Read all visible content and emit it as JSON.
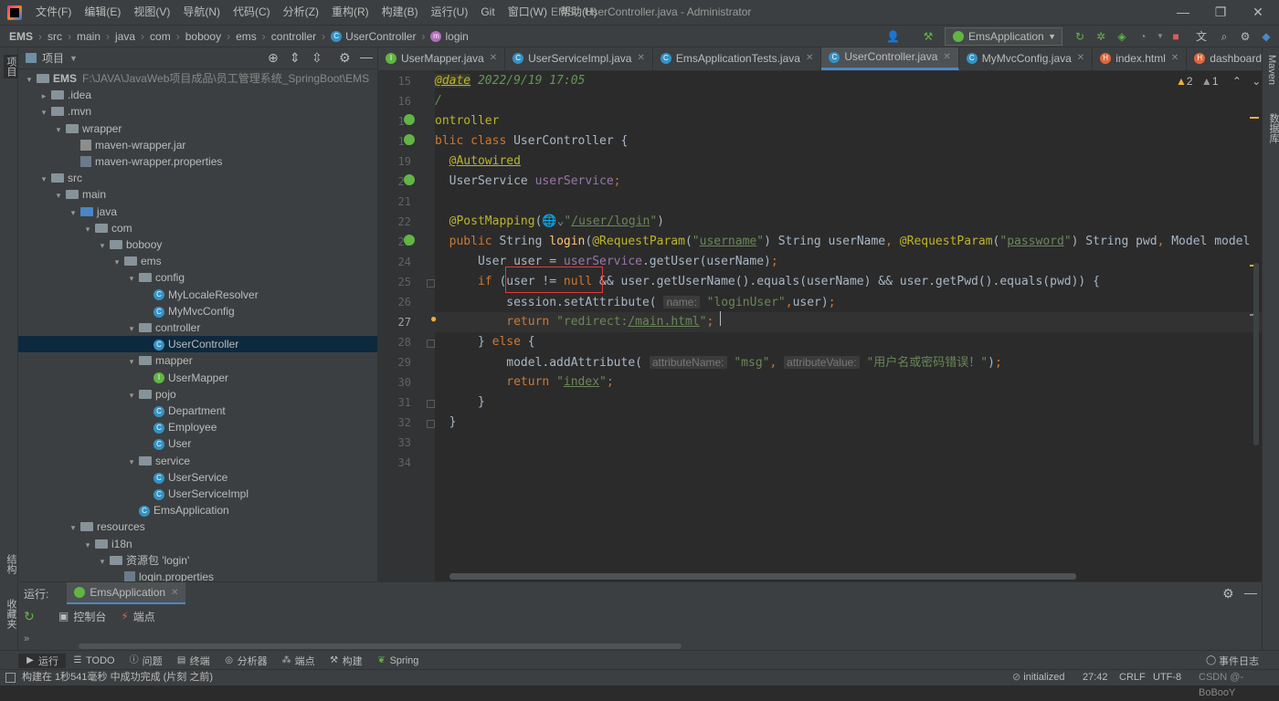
{
  "menubar": {
    "items": [
      "文件(F)",
      "编辑(E)",
      "视图(V)",
      "导航(N)",
      "代码(C)",
      "分析(Z)",
      "重构(R)",
      "构建(B)",
      "运行(U)",
      "Git",
      "窗口(W)",
      "帮助(H)"
    ],
    "window_title": "EMS - UserController.java - Administrator"
  },
  "navbar": {
    "crumbs": [
      "EMS",
      "src",
      "main",
      "java",
      "com",
      "bobooy",
      "ems",
      "controller",
      "UserController",
      "login"
    ],
    "run_config": "EmsApplication"
  },
  "project_panel": {
    "title": "项目",
    "tree": [
      {
        "depth": 0,
        "arrow": "▾",
        "icon": "folder",
        "label": "EMS",
        "extra": "F:\\JAVA\\JavaWeb项目成品\\员工管理系统_SpringBoot\\EMS",
        "bold": true
      },
      {
        "depth": 1,
        "arrow": "▸",
        "icon": "folder",
        "label": ".idea"
      },
      {
        "depth": 1,
        "arrow": "▾",
        "icon": "folder",
        "label": ".mvn"
      },
      {
        "depth": 2,
        "arrow": "▾",
        "icon": "folder",
        "label": "wrapper"
      },
      {
        "depth": 3,
        "arrow": "",
        "icon": "jar",
        "label": "maven-wrapper.jar"
      },
      {
        "depth": 3,
        "arrow": "",
        "icon": "prop",
        "label": "maven-wrapper.properties"
      },
      {
        "depth": 1,
        "arrow": "▾",
        "icon": "folder",
        "label": "src"
      },
      {
        "depth": 2,
        "arrow": "▾",
        "icon": "folder",
        "label": "main"
      },
      {
        "depth": 3,
        "arrow": "▾",
        "icon": "src",
        "label": "java"
      },
      {
        "depth": 4,
        "arrow": "▾",
        "icon": "folder",
        "label": "com"
      },
      {
        "depth": 5,
        "arrow": "▾",
        "icon": "folder",
        "label": "bobooy"
      },
      {
        "depth": 6,
        "arrow": "▾",
        "icon": "folder",
        "label": "ems"
      },
      {
        "depth": 7,
        "arrow": "▾",
        "icon": "folder",
        "label": "config"
      },
      {
        "depth": 8,
        "arrow": "",
        "icon": "class",
        "label": "MyLocaleResolver"
      },
      {
        "depth": 8,
        "arrow": "",
        "icon": "class",
        "label": "MyMvcConfig"
      },
      {
        "depth": 7,
        "arrow": "▾",
        "icon": "folder",
        "label": "controller"
      },
      {
        "depth": 8,
        "arrow": "",
        "icon": "class",
        "label": "UserController",
        "selected": true
      },
      {
        "depth": 7,
        "arrow": "▾",
        "icon": "folder",
        "label": "mapper"
      },
      {
        "depth": 8,
        "arrow": "",
        "icon": "iface",
        "label": "UserMapper"
      },
      {
        "depth": 7,
        "arrow": "▾",
        "icon": "folder",
        "label": "pojo"
      },
      {
        "depth": 8,
        "arrow": "",
        "icon": "class",
        "label": "Department"
      },
      {
        "depth": 8,
        "arrow": "",
        "icon": "class",
        "label": "Employee"
      },
      {
        "depth": 8,
        "arrow": "",
        "icon": "class",
        "label": "User"
      },
      {
        "depth": 7,
        "arrow": "▾",
        "icon": "folder",
        "label": "service"
      },
      {
        "depth": 8,
        "arrow": "",
        "icon": "class",
        "label": "UserService"
      },
      {
        "depth": 8,
        "arrow": "",
        "icon": "class",
        "label": "UserServiceImpl"
      },
      {
        "depth": 7,
        "arrow": "",
        "icon": "app",
        "label": "EmsApplication"
      },
      {
        "depth": 3,
        "arrow": "▾",
        "icon": "res",
        "label": "resources"
      },
      {
        "depth": 4,
        "arrow": "▾",
        "icon": "folder",
        "label": "i18n"
      },
      {
        "depth": 5,
        "arrow": "▾",
        "icon": "folder",
        "label": "资源包 'login'"
      },
      {
        "depth": 6,
        "arrow": "",
        "icon": "prop",
        "label": "login.properties"
      }
    ]
  },
  "tabs": [
    {
      "label": "UserMapper.java",
      "icon": "I",
      "color": "#62b543"
    },
    {
      "label": "UserServiceImpl.java",
      "icon": "C",
      "color": "#3592c4"
    },
    {
      "label": "EmsApplicationTests.java",
      "icon": "C",
      "color": "#3592c4"
    },
    {
      "label": "UserController.java",
      "icon": "C",
      "color": "#3592c4",
      "active": true
    },
    {
      "label": "MyMvcConfig.java",
      "icon": "C",
      "color": "#3592c4"
    },
    {
      "label": "index.html",
      "icon": "H",
      "color": "#e0673c"
    },
    {
      "label": "dashboard",
      "icon": "H",
      "color": "#e0673c"
    }
  ],
  "inspections": {
    "warnings": "2",
    "weak": "1"
  },
  "editor": {
    "line_numbers": [
      "15",
      "16",
      "17",
      "18",
      "19",
      "20",
      "21",
      "22",
      "23",
      "24",
      "25",
      "26",
      "27",
      "28",
      "29",
      "30",
      "31",
      "32",
      "33",
      "34"
    ],
    "current_line_index": 12
  },
  "run_panel": {
    "label": "运行:",
    "config": "EmsApplication",
    "tab_console": "控制台",
    "tab_endpoints": "端点"
  },
  "bottom_tools": [
    "运行",
    "TODO",
    "问题",
    "终端",
    "分析器",
    "端点",
    "构建",
    "Spring"
  ],
  "bottom_right": "事件日志",
  "statusbar": {
    "message": "构建在 1秒541毫秒 中成功完成 (片刻 之前)",
    "spring_status": "initialized",
    "position": "27:42",
    "line_sep": "CRLF",
    "encoding": "UTF-8",
    "watermark": "CSDN @-BoBooY"
  },
  "side_labels": {
    "left_top": "项目",
    "left_mid": "结构",
    "left_bottom": "收藏夹",
    "right_top": "Maven",
    "right_mid": "数据库"
  },
  "colors": {
    "keyword": "#cc7832",
    "annotation": "#bbb529",
    "string": "#6a8759",
    "field": "#9876aa",
    "method": "#ffc66d",
    "highlight_box": "#e33a3a"
  }
}
